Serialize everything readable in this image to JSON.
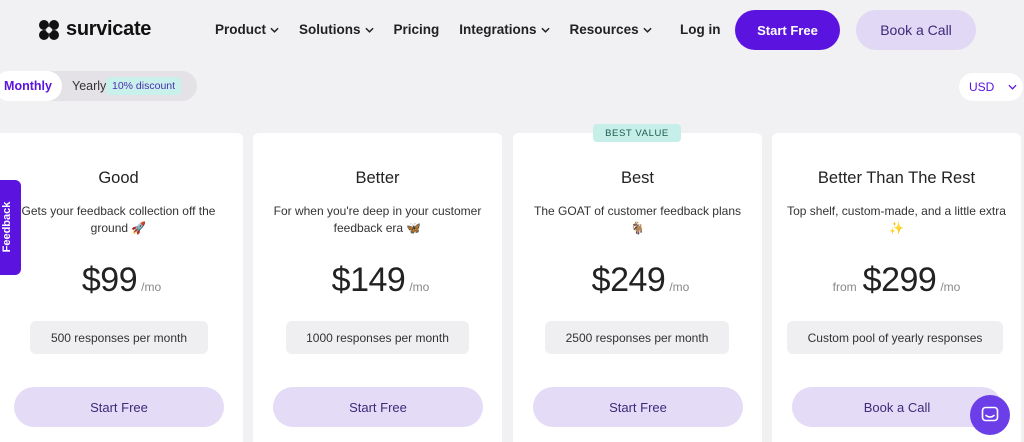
{
  "brand": {
    "name": "survicate"
  },
  "nav": {
    "items": [
      {
        "label": "Product",
        "has_dropdown": true
      },
      {
        "label": "Solutions",
        "has_dropdown": true
      },
      {
        "label": "Pricing",
        "has_dropdown": false
      },
      {
        "label": "Integrations",
        "has_dropdown": true
      },
      {
        "label": "Resources",
        "has_dropdown": true
      }
    ],
    "login": "Log in",
    "start_free": "Start Free",
    "book_call": "Book a Call"
  },
  "billing": {
    "monthly": "Monthly",
    "yearly": "Yearly",
    "discount": "10% discount",
    "selected": "Monthly"
  },
  "currency": {
    "selected": "USD"
  },
  "feedback_tab": {
    "label": "Feedback"
  },
  "best_badge": "BEST VALUE",
  "plans": [
    {
      "name": "Good",
      "desc": "Gets your feedback collection off the ground 🚀",
      "prefix": "",
      "price": "$99",
      "period": "/mo",
      "responses": "500 responses per month",
      "cta": "Start Free"
    },
    {
      "name": "Better",
      "desc": "For when you're deep in your customer feedback era 🦋",
      "prefix": "",
      "price": "$149",
      "period": "/mo",
      "responses": "1000 responses per month",
      "cta": "Start Free"
    },
    {
      "name": "Best",
      "desc": "The GOAT of customer feedback plans 🐐",
      "prefix": "",
      "price": "$249",
      "period": "/mo",
      "responses": "2500 responses per month",
      "cta": "Start Free"
    },
    {
      "name": "Better Than The Rest",
      "desc": "Top shelf, custom-made, and a little extra ✨",
      "prefix": "from",
      "price": "$299",
      "period": "/mo",
      "responses": "Custom pool of yearly responses",
      "cta": "Book a Call"
    }
  ],
  "colors": {
    "accent": "#5b13e0",
    "soft_button": "#e4dbf7",
    "badge": "#c5efe8"
  },
  "icons": [
    "survicate-logo-icon",
    "chevron-down-icon",
    "chat-icon"
  ]
}
